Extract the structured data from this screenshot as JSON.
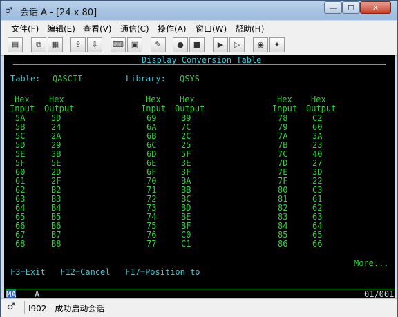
{
  "window": {
    "title": "会话 A - [24 x 80]",
    "app_icon_glyph": "♂",
    "min_glyph": "—",
    "max_glyph": "☐",
    "close_glyph": "✕"
  },
  "menu": [
    "文件(F)",
    "编辑(E)",
    "查看(V)",
    "通信(C)",
    "操作(A)",
    "窗口(W)",
    "帮助(H)"
  ],
  "toolbar": [
    {
      "icon": "print-screen-icon",
      "glyph": "▤"
    },
    {
      "icon": "copy-icon",
      "glyph": "⧉"
    },
    {
      "icon": "paste-icon",
      "glyph": "▦"
    },
    {
      "icon": "send-file-icon",
      "glyph": "⇪"
    },
    {
      "icon": "receive-file-icon",
      "glyph": "⇩"
    },
    {
      "icon": "display-keyboard-icon",
      "glyph": "⌨"
    },
    {
      "icon": "macro-icon",
      "glyph": "▣"
    },
    {
      "icon": "customize-icon",
      "glyph": "✎"
    },
    {
      "icon": "record-macro-icon",
      "glyph": "●"
    },
    {
      "icon": "stop-macro-icon",
      "glyph": "■"
    },
    {
      "icon": "play-macro-icon",
      "glyph": "▶"
    },
    {
      "icon": "run-macro-icon",
      "glyph": "▷"
    },
    {
      "icon": "web-icon",
      "glyph": "◉"
    },
    {
      "icon": "help-icon",
      "glyph": "✦"
    }
  ],
  "terminal": {
    "heading": "Display Conversion Table",
    "table_label": "Table:",
    "table_value": "QASCII",
    "library_label": "Library:",
    "library_value": "QSYS",
    "col_head_1": "Hex",
    "col_head_2_in": "Input",
    "col_head_2_out": "Output",
    "columns": [
      {
        "input": [
          "5A",
          "5B",
          "5C",
          "5D",
          "5E",
          "5F",
          "60",
          "61",
          "62",
          "63",
          "64",
          "65",
          "66",
          "67",
          "68"
        ],
        "output": [
          "5D",
          "24",
          "2A",
          "29",
          "3B",
          "5E",
          "2D",
          "2F",
          "B2",
          "B3",
          "B4",
          "B5",
          "B6",
          "B7",
          "B8"
        ]
      },
      {
        "input": [
          "69",
          "6A",
          "6B",
          "6C",
          "6D",
          "6E",
          "6F",
          "70",
          "71",
          "72",
          "73",
          "74",
          "75",
          "76",
          "77"
        ],
        "output": [
          "B9",
          "7C",
          "2C",
          "25",
          "5F",
          "3E",
          "3F",
          "BA",
          "BB",
          "BC",
          "BD",
          "BE",
          "BF",
          "C0",
          "C1"
        ]
      },
      {
        "input": [
          "78",
          "79",
          "7A",
          "7B",
          "7C",
          "7D",
          "7E",
          "7F",
          "80",
          "81",
          "82",
          "83",
          "84",
          "85",
          "86"
        ],
        "output": [
          "C2",
          "60",
          "3A",
          "23",
          "40",
          "27",
          "3D",
          "22",
          "C3",
          "61",
          "62",
          "63",
          "64",
          "65",
          "66"
        ]
      }
    ],
    "more": "More...",
    "fkeys": "F3=Exit   F12=Cancel   F17=Position to",
    "status_left": "MA",
    "status_mid": "A",
    "status_right": "01/001"
  },
  "statusbar": {
    "icon_glyph": "♂",
    "message": "I902 - 成功启动会话"
  }
}
